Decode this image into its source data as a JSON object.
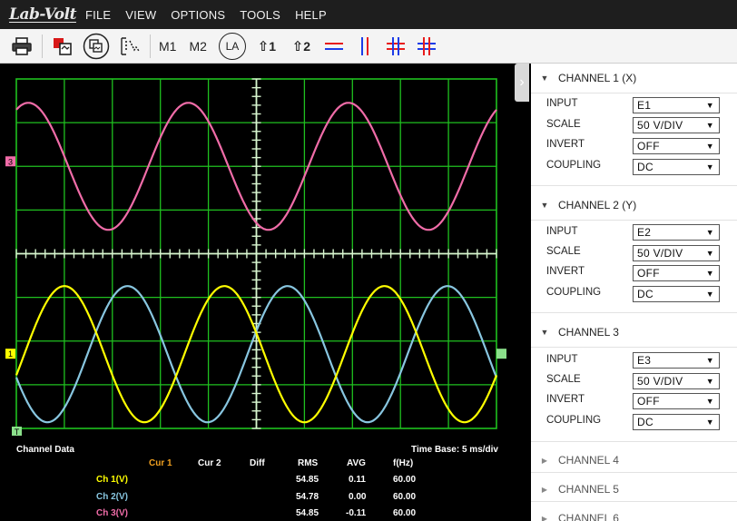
{
  "app": {
    "logo": "Lab-Volt"
  },
  "menu": [
    "FILE",
    "VIEW",
    "OPTIONS",
    "TOOLS",
    "HELP"
  ],
  "toolbar": {
    "m1": "M1",
    "m2": "M2",
    "la": "LA",
    "cursor1": "1",
    "cursor2": "2"
  },
  "scope": {
    "channel_markers": [
      "3",
      "1",
      "T"
    ],
    "timebase_label": "Time Base: 5 ms/div"
  },
  "colors": {
    "ch1": "#ffff00",
    "ch2": "#88c6e0",
    "ch3": "#f06ca8",
    "grid": "#1fc01f",
    "cursor1_header": "#f0a020"
  },
  "chart_data": {
    "type": "line",
    "xlim": [
      0,
      50
    ],
    "xlabel": "Time Base: 5 ms/div",
    "series": [
      {
        "name": "Ch 1(V)",
        "frequency_hz": 60,
        "rms": 54.85
      },
      {
        "name": "Ch 2(V)",
        "frequency_hz": 60,
        "rms": 54.78
      },
      {
        "name": "Ch 3(V)",
        "frequency_hz": 60,
        "rms": 54.85
      }
    ]
  },
  "channel_data": {
    "title": "Channel Data",
    "columns": [
      "Cur 1",
      "Cur 2",
      "Diff",
      "RMS",
      "AVG",
      "f(Hz)"
    ],
    "rows": [
      {
        "name": "Ch 1(V)",
        "rms": "54.85",
        "avg": "0.11",
        "f": "60.00"
      },
      {
        "name": "Ch 2(V)",
        "rms": "54.78",
        "avg": "0.00",
        "f": "60.00"
      },
      {
        "name": "Ch 3(V)",
        "rms": "54.85",
        "avg": "-0.11",
        "f": "60.00"
      }
    ]
  },
  "panel": {
    "field_labels": [
      "INPUT",
      "SCALE",
      "INVERT",
      "COUPLING"
    ],
    "channels": [
      {
        "title": "CHANNEL 1 (X)",
        "input": "E1",
        "scale": "50 V/DIV",
        "invert": "OFF",
        "coupling": "DC"
      },
      {
        "title": "CHANNEL 2 (Y)",
        "input": "E2",
        "scale": "50 V/DIV",
        "invert": "OFF",
        "coupling": "DC"
      },
      {
        "title": "CHANNEL 3",
        "input": "E3",
        "scale": "50 V/DIV",
        "invert": "OFF",
        "coupling": "DC"
      }
    ],
    "collapsed": [
      "CHANNEL 4",
      "CHANNEL 5",
      "CHANNEL 6"
    ]
  }
}
